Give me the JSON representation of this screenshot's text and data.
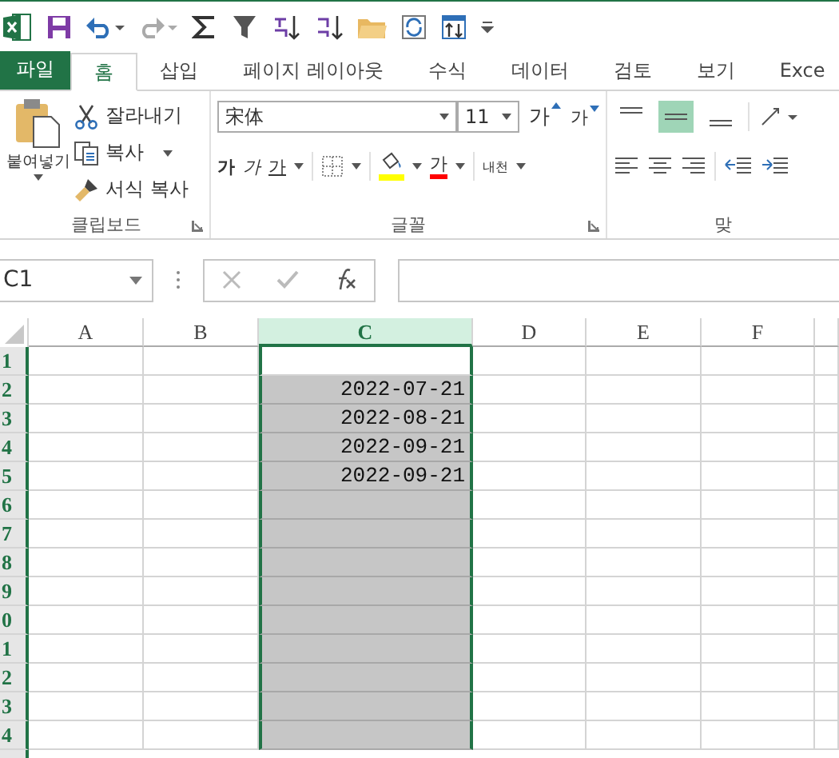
{
  "tabs": [
    {
      "label": "파일",
      "kind": "file",
      "selected": false
    },
    {
      "label": "홈",
      "kind": "tab",
      "selected": true
    },
    {
      "label": "삽입",
      "kind": "tab",
      "selected": false
    },
    {
      "label": "페이지 레이아웃",
      "kind": "tab",
      "selected": false
    },
    {
      "label": "수식",
      "kind": "tab",
      "selected": false
    },
    {
      "label": "데이터",
      "kind": "tab",
      "selected": false
    },
    {
      "label": "검토",
      "kind": "tab",
      "selected": false
    },
    {
      "label": "보기",
      "kind": "tab",
      "selected": false
    },
    {
      "label": "Exce",
      "kind": "tab",
      "selected": false
    }
  ],
  "clipboard": {
    "paste": "붙여넣기",
    "cut": "잘라내기",
    "copy": "복사",
    "format_painter": "서식 복사",
    "label": "클립보드"
  },
  "font": {
    "name": "宋体",
    "size": "11",
    "grow": "가",
    "shrink": "가",
    "bold": "가",
    "italic": "가",
    "underline": "가",
    "font_color": "가",
    "phonetic": "내천",
    "label": "글꼴"
  },
  "alignment": {
    "label": "맞",
    "vertical": [
      {
        "selected": false
      },
      {
        "selected": true
      },
      {
        "selected": false
      }
    ]
  },
  "formula_bar": {
    "name_box": "C1"
  },
  "sheet": {
    "columns": [
      {
        "label": "A",
        "selected": false
      },
      {
        "label": "B",
        "selected": false
      },
      {
        "label": "C",
        "selected": true
      },
      {
        "label": "D",
        "selected": false
      },
      {
        "label": "E",
        "selected": false
      },
      {
        "label": "F",
        "selected": false
      }
    ],
    "rows": [
      {
        "header": "1",
        "selected": true,
        "active": true
      },
      {
        "header": "2",
        "selected": true,
        "active": false,
        "C": "2022-07-21"
      },
      {
        "header": "3",
        "selected": true,
        "active": false,
        "C": "2022-08-21"
      },
      {
        "header": "4",
        "selected": true,
        "active": false,
        "C": "2022-09-21"
      },
      {
        "header": "5",
        "selected": true,
        "active": false,
        "C": "2022-09-21"
      },
      {
        "header": "6",
        "selected": true,
        "active": false
      },
      {
        "header": "7",
        "selected": true,
        "active": false
      },
      {
        "header": "8",
        "selected": true,
        "active": false
      },
      {
        "header": "9",
        "selected": true,
        "active": false
      },
      {
        "header": "0",
        "selected": true,
        "active": false
      },
      {
        "header": "1",
        "selected": true,
        "active": false
      },
      {
        "header": "2",
        "selected": true,
        "active": false
      },
      {
        "header": "3",
        "selected": true,
        "active": false
      },
      {
        "header": "4",
        "selected": true,
        "active": false
      }
    ]
  }
}
